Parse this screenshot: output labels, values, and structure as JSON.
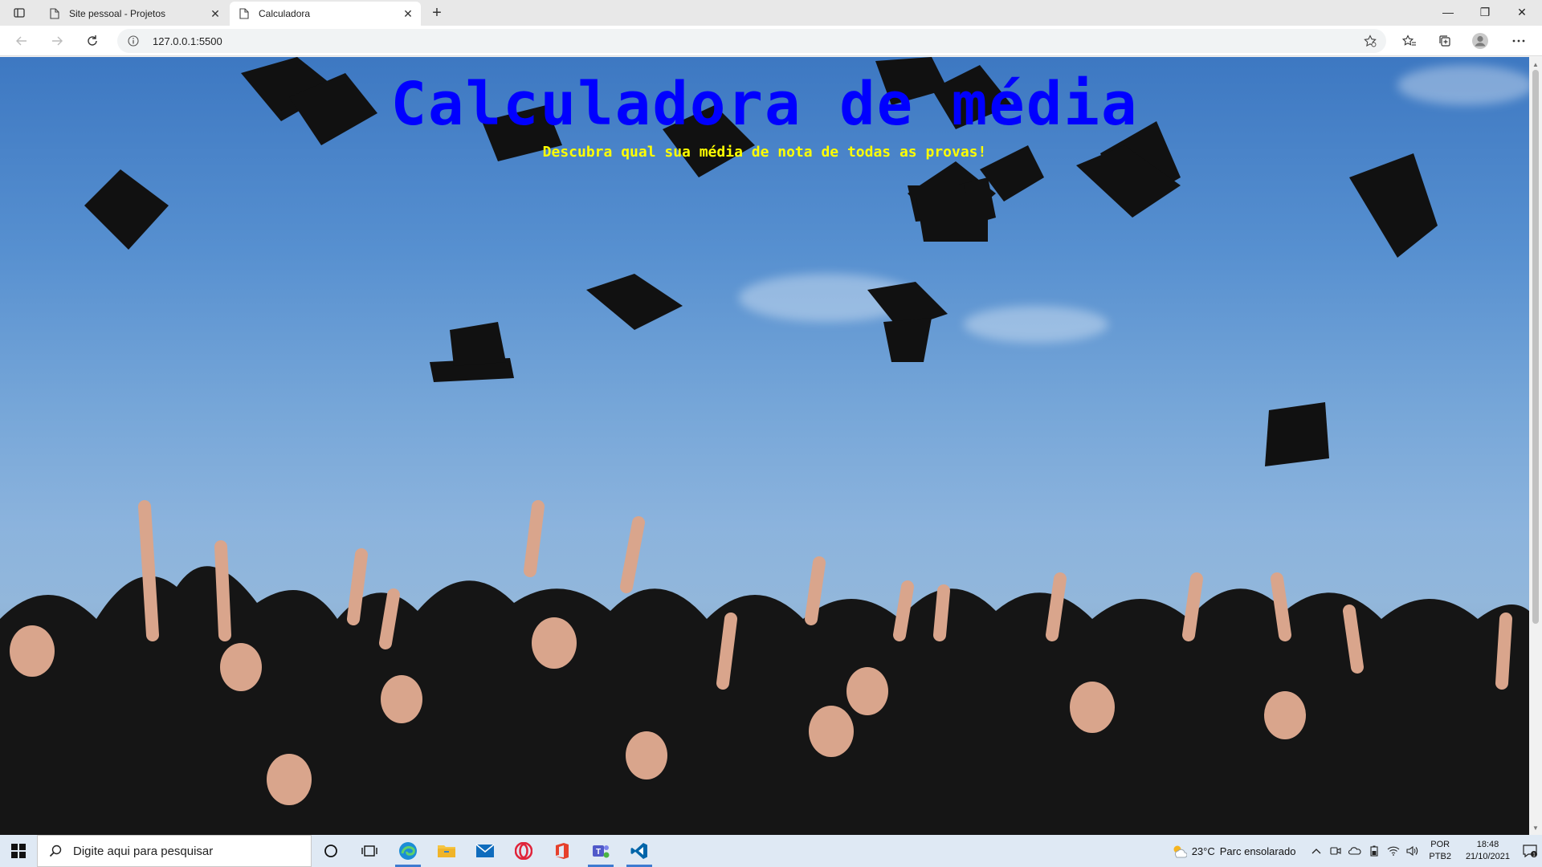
{
  "browser": {
    "tabs": [
      {
        "title": "Site pessoal - Projetos",
        "active": false
      },
      {
        "title": "Calculadora",
        "active": true
      }
    ],
    "new_tab_label": "+",
    "close_label": "✕",
    "url": "127.0.0.1:5500",
    "window_controls": {
      "minimize": "—",
      "restore": "❐",
      "close": "✕"
    }
  },
  "page": {
    "title": "Calculadora de média",
    "subtitle": "Descubra qual sua média de nota de todas as provas!",
    "title_color": "#0000ff",
    "subtitle_color": "#ffff00"
  },
  "taskbar": {
    "search_placeholder": "Digite aqui para pesquisar",
    "apps": [
      "cortana-icon",
      "task-view-icon",
      "edge-icon",
      "file-explorer-icon",
      "mail-icon",
      "opera-icon",
      "office-icon",
      "teams-icon",
      "vscode-icon"
    ],
    "weather_temp": "23°C",
    "weather_text": "Parc ensolarado",
    "lang_line1": "POR",
    "lang_line2": "PTB2",
    "time": "18:48",
    "date": "21/10/2021",
    "notification_count": "1"
  }
}
